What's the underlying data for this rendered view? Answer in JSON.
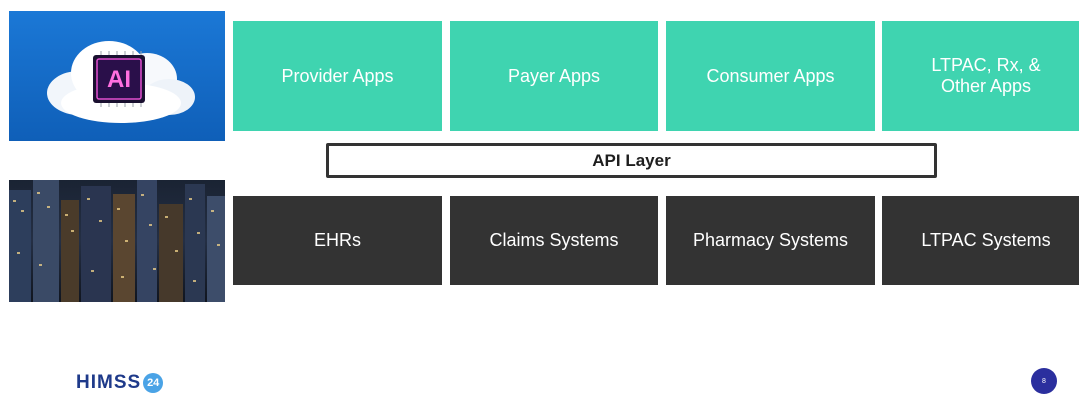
{
  "api_layer": {
    "label": "API Layer"
  },
  "apps": [
    {
      "label": "Provider Apps"
    },
    {
      "label": "Payer Apps"
    },
    {
      "label": "Consumer Apps"
    },
    {
      "label": "LTPAC, Rx, &\nOther Apps"
    }
  ],
  "systems": [
    {
      "label": "EHRs"
    },
    {
      "label": "Claims Systems"
    },
    {
      "label": "Pharmacy Systems"
    },
    {
      "label": "LTPAC Systems"
    }
  ],
  "ai_chip": {
    "label": "AI"
  },
  "footer": {
    "logo_text": "HIMSS",
    "logo_badge": "24",
    "page_number": "8"
  },
  "colors": {
    "app_box": "#3fd4b0",
    "system_box": "#333333",
    "logo": "#1e3a8a",
    "page_badge": "#2b2f9e"
  }
}
